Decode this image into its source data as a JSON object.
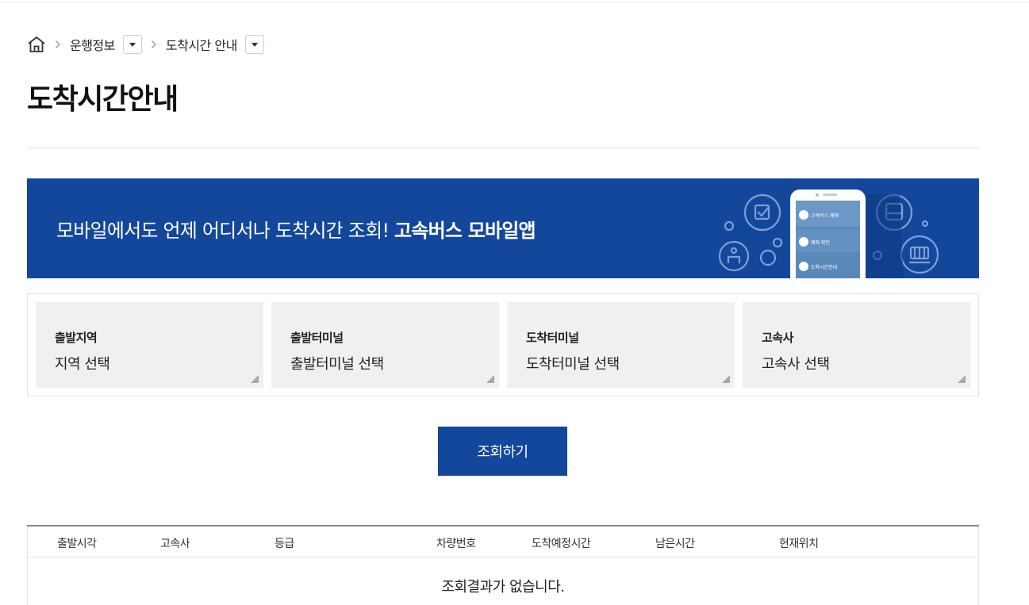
{
  "breadcrumb": {
    "home_icon": "home-icon",
    "items": [
      {
        "label": "운행정보"
      },
      {
        "label": "도착시간 안내"
      }
    ]
  },
  "page_title": "도착시간안내",
  "banner": {
    "text": "모바일에서도 언제 어디서나 도착시간 조회!",
    "highlight": "고속버스 모바일앱",
    "background_color": "#13479b",
    "phone_menu": [
      "고속버스 예매",
      "예매 확인",
      "도착시간안내"
    ]
  },
  "selectors": [
    {
      "label": "출발지역",
      "value": "지역 선택"
    },
    {
      "label": "출발터미널",
      "value": "출발터미널 선택"
    },
    {
      "label": "도착터미널",
      "value": "도착터미널 선택"
    },
    {
      "label": "고속사",
      "value": "고속사 선택"
    }
  ],
  "search_button": "조회하기",
  "table": {
    "columns": [
      "출발시각",
      "고속사",
      "등급",
      "차량번호",
      "도착예정시간",
      "남은시간",
      "현재위치"
    ],
    "empty_message": "조회결과가 없습니다."
  },
  "colors": {
    "accent": "#13479b",
    "selector_bg": "#f0f0f0"
  }
}
